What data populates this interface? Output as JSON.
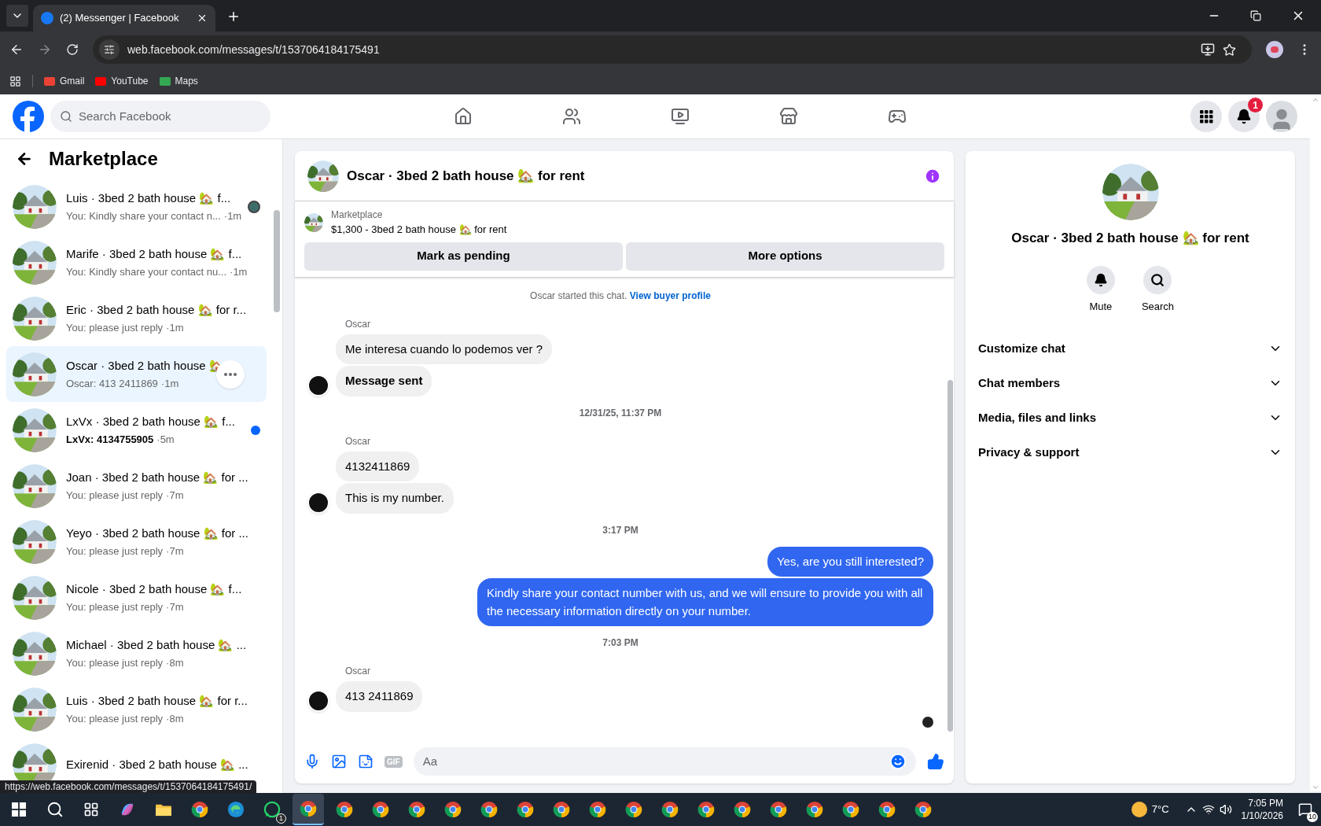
{
  "browser": {
    "tab_title": "(2) Messenger | Facebook",
    "url": "web.facebook.com/messages/t/1537064184175491",
    "bookmarks": [
      "Gmail",
      "YouTube",
      "Maps"
    ],
    "status_url": "https://web.facebook.com/messages/t/1537064184175491/"
  },
  "facebook": {
    "search_placeholder": "Search Facebook",
    "nav": [
      {
        "kind": "home",
        "selected": false
      },
      {
        "kind": "friends",
        "selected": false
      },
      {
        "kind": "video",
        "selected": false
      },
      {
        "kind": "marketplace",
        "selected": false
      },
      {
        "kind": "gaming",
        "selected": false
      }
    ],
    "notification_count": "1"
  },
  "sidebar": {
    "title": "Marketplace",
    "conversations": [
      {
        "title": "Luis · 3bed 2 bath house 🏡 f...",
        "preview": "You: Kindly share your contact n...",
        "time": "·1m",
        "selected": false,
        "unread": false,
        "seen": true
      },
      {
        "title": "Marife · 3bed 2 bath house 🏡 f...",
        "preview": "You: Kindly share your contact nu...",
        "time": "·1m",
        "selected": false,
        "unread": false,
        "seen": false
      },
      {
        "title": "Eric · 3bed 2 bath house 🏡 for r...",
        "preview": "You: please just reply",
        "time": "·1m",
        "selected": false,
        "unread": false,
        "seen": false
      },
      {
        "title": "Oscar · 3bed 2 bath house 🏡",
        "preview": "Oscar: 413 2411869",
        "time": "·1m",
        "selected": true,
        "unread": false,
        "seen": false
      },
      {
        "title": "LxVx · 3bed 2 bath house 🏡 f...",
        "preview": "LxVx: 4134755905",
        "time": "·5m",
        "selected": false,
        "unread": true,
        "seen": false
      },
      {
        "title": "Joan · 3bed 2 bath house 🏡 for ...",
        "preview": "You: please just reply",
        "time": "·7m",
        "selected": false,
        "unread": false,
        "seen": false
      },
      {
        "title": "Yeyo · 3bed 2 bath house 🏡 for ...",
        "preview": "You: please just reply",
        "time": "·7m",
        "selected": false,
        "unread": false,
        "seen": false
      },
      {
        "title": "Nicole · 3bed 2 bath house 🏡 f...",
        "preview": "You: please just reply",
        "time": "·7m",
        "selected": false,
        "unread": false,
        "seen": false
      },
      {
        "title": "Michael · 3bed 2 bath house 🏡 ...",
        "preview": "You: please just reply",
        "time": "·8m",
        "selected": false,
        "unread": false,
        "seen": false
      },
      {
        "title": "Luis · 3bed 2 bath house 🏡 for r...",
        "preview": "You: please just reply",
        "time": "·8m",
        "selected": false,
        "unread": false,
        "seen": false
      },
      {
        "title": "Exirenid · 3bed 2 bath house 🏡 ...",
        "selected": false,
        "unread": false,
        "seen": false
      }
    ]
  },
  "chat": {
    "title": "Oscar · 3bed 2 bath house 🏡 for rent",
    "listing": {
      "source": "Marketplace",
      "summary": "$1,300 - 3bed 2 bath house 🏡 for rent"
    },
    "actions": [
      "Mark as pending",
      "More options"
    ],
    "messages": [
      {
        "kind": "notice",
        "text": "Oscar started this chat.",
        "link": "View buyer profile"
      },
      {
        "kind": "sender",
        "text": "Oscar"
      },
      {
        "kind": "in",
        "text": "Me interesa cuando lo podemos ver ?",
        "avatar": false,
        "bold": false
      },
      {
        "kind": "in",
        "text": "Message sent",
        "avatar": true,
        "bold": true
      },
      {
        "kind": "time",
        "text": "12/31/25, 11:37 PM"
      },
      {
        "kind": "sender",
        "text": "Oscar"
      },
      {
        "kind": "in",
        "text": "4132411869",
        "avatar": false,
        "bold": false
      },
      {
        "kind": "in",
        "text": "This is my number.",
        "avatar": true,
        "bold": false
      },
      {
        "kind": "time",
        "text": "3:17 PM"
      },
      {
        "kind": "out",
        "text": "Yes, are you still interested?"
      },
      {
        "kind": "out",
        "text": "Kindly share your contact number with us, and we will ensure to provide you with all the necessary information directly on your number."
      },
      {
        "kind": "time",
        "text": "7:03 PM"
      },
      {
        "kind": "sender",
        "text": "Oscar"
      },
      {
        "kind": "in",
        "text": "413 2411869",
        "avatar": true,
        "bold": false
      }
    ],
    "composer": {
      "placeholder": "Aa",
      "gif_label": "GIF"
    }
  },
  "details": {
    "title": "Oscar · 3bed 2 bath house 🏡 for rent",
    "buttons": [
      {
        "kind": "mute",
        "label": "Mute"
      },
      {
        "kind": "search",
        "label": "Search"
      }
    ],
    "sections": [
      {
        "label": "Customize chat",
        "expanded": false
      },
      {
        "label": "Chat members",
        "expanded": false
      },
      {
        "label": "Media, files and links",
        "expanded": false
      },
      {
        "label": "Privacy & support",
        "expanded": false
      }
    ]
  },
  "taskbar": {
    "apps": [
      {
        "kind": "start",
        "selected": false
      },
      {
        "kind": "search",
        "selected": false
      },
      {
        "kind": "taskview",
        "selected": false
      },
      {
        "kind": "copilot",
        "selected": false
      },
      {
        "kind": "files",
        "selected": false
      },
      {
        "kind": "chrome",
        "selected": false
      },
      {
        "kind": "edge",
        "selected": false
      },
      {
        "kind": "whatsapp",
        "badge": "1",
        "selected": false
      },
      {
        "kind": "chrome",
        "selected": true
      },
      {
        "kind": "chrome",
        "selected": false
      },
      {
        "kind": "chrome",
        "selected": false
      },
      {
        "kind": "chrome",
        "selected": false
      },
      {
        "kind": "chrome",
        "selected": false
      },
      {
        "kind": "chrome",
        "selected": false
      },
      {
        "kind": "chrome",
        "selected": false
      },
      {
        "kind": "chrome",
        "selected": false
      },
      {
        "kind": "chrome",
        "selected": false
      },
      {
        "kind": "chrome",
        "selected": false
      },
      {
        "kind": "chrome",
        "selected": false
      },
      {
        "kind": "chrome",
        "selected": false
      },
      {
        "kind": "chrome",
        "selected": false
      },
      {
        "kind": "chrome",
        "selected": false
      },
      {
        "kind": "chrome",
        "selected": false
      },
      {
        "kind": "chrome",
        "selected": false
      },
      {
        "kind": "chrome",
        "selected": false
      },
      {
        "kind": "chrome",
        "selected": false
      }
    ],
    "weather": "7°C",
    "time": "7:05 PM",
    "date": "1/10/2026",
    "notifications": "10"
  }
}
